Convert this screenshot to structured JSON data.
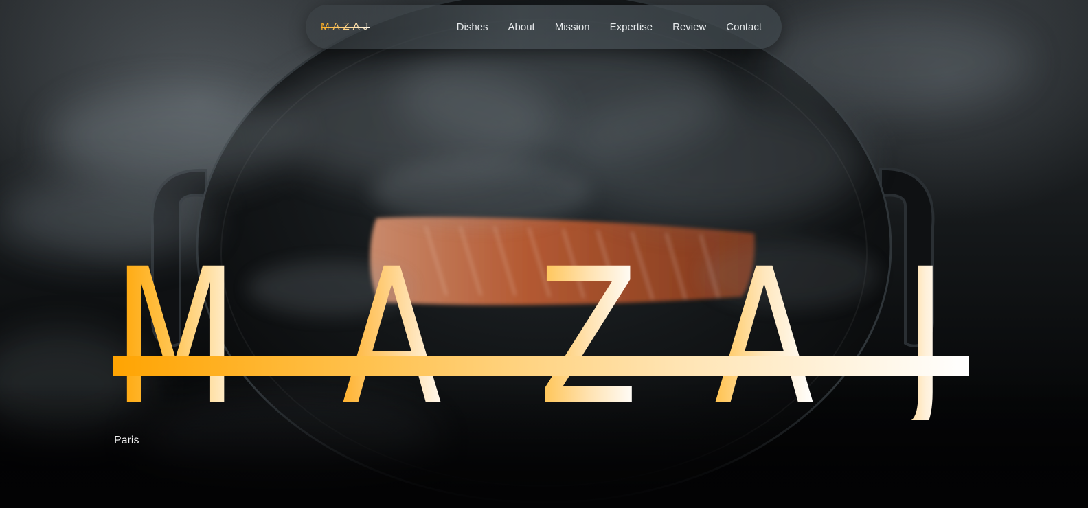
{
  "brand": {
    "logo_text": "MAZAJ",
    "hero_letters": [
      "M",
      "A",
      "Z",
      "A",
      "J"
    ],
    "city": "Paris"
  },
  "nav": {
    "links": [
      {
        "label": "Dishes"
      },
      {
        "label": "About"
      },
      {
        "label": "Mission"
      },
      {
        "label": "Expertise"
      },
      {
        "label": "Review"
      },
      {
        "label": "Contact"
      }
    ]
  },
  "colors": {
    "accent_orange": "#ffa402",
    "accent_light": "#fff6e6",
    "nav_text": "#e7eaec",
    "background": "#050607"
  },
  "background_image": {
    "subject": "salmon fillet in a dark cast-iron pan with smoke"
  }
}
